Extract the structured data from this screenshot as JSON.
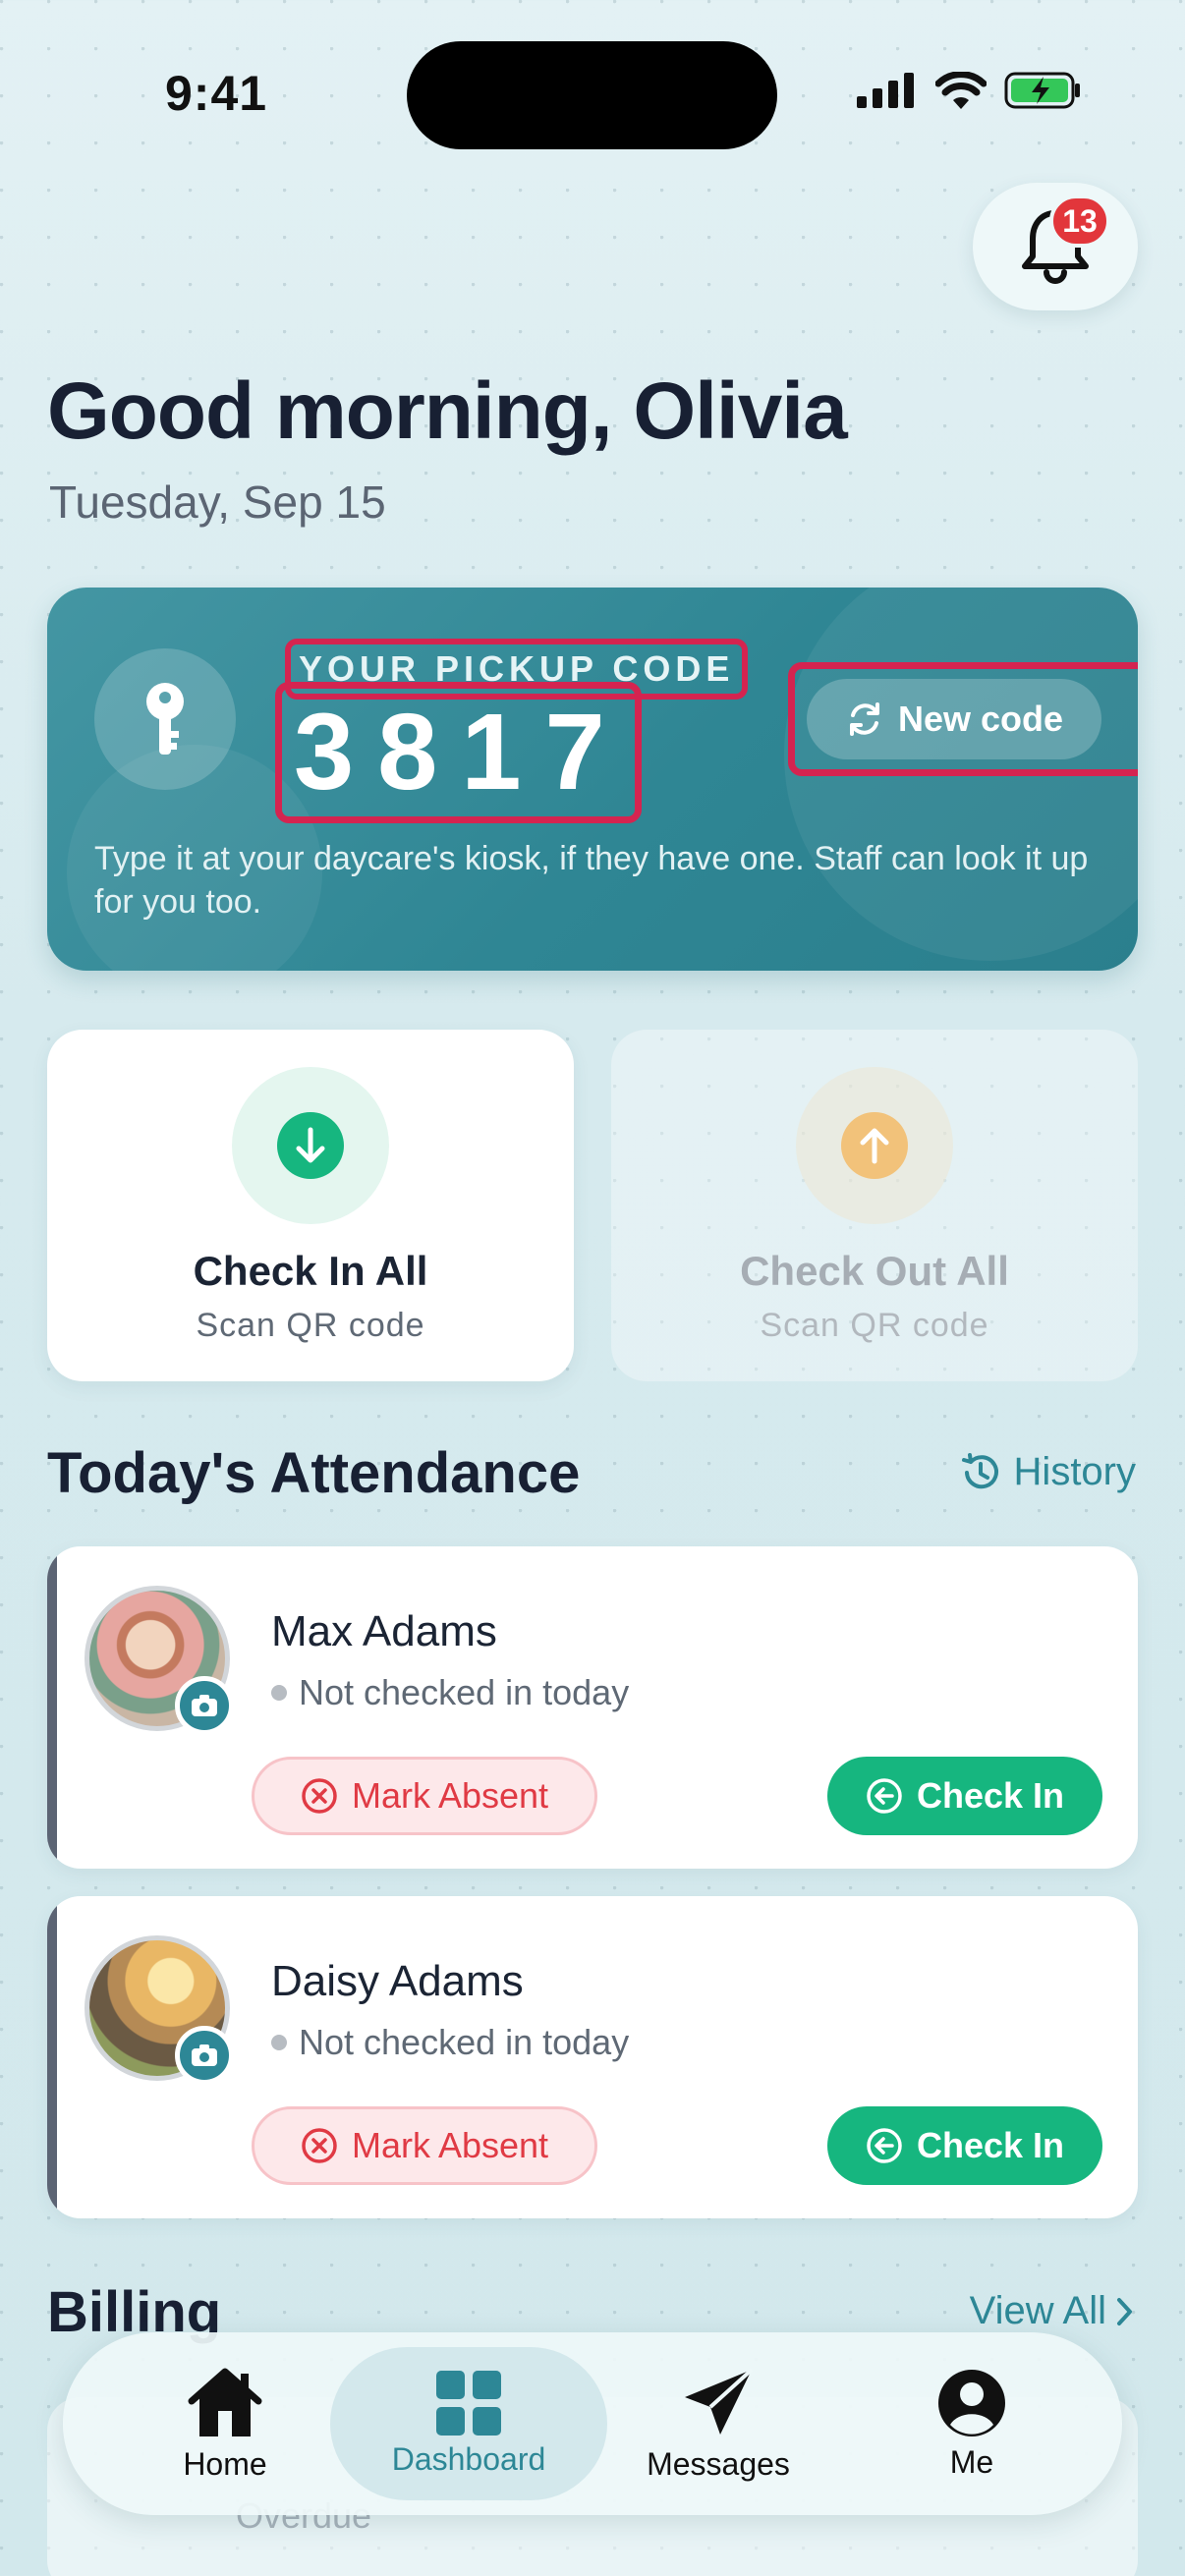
{
  "status_bar": {
    "time": "9:41"
  },
  "notifications": {
    "badge_count": "13"
  },
  "header": {
    "greeting": "Good morning, Olivia",
    "date": "Tuesday, Sep 15"
  },
  "pickup": {
    "label": "YOUR PICKUP CODE",
    "code": "3817",
    "new_code_label": "New code",
    "description": "Type it at your daycare's kiosk, if they have one. Staff can look it up for you too."
  },
  "actions": {
    "check_in": {
      "title": "Check In All",
      "subtitle": "Scan QR code"
    },
    "check_out": {
      "title": "Check Out All",
      "subtitle": "Scan QR code"
    }
  },
  "attendance": {
    "title": "Today's Attendance",
    "history_label": "History",
    "children": [
      {
        "name": "Max Adams",
        "status": "Not checked in today",
        "absent_label": "Mark Absent",
        "checkin_label": "Check In"
      },
      {
        "name": "Daisy Adams",
        "status": "Not checked in today",
        "absent_label": "Mark Absent",
        "checkin_label": "Check In"
      }
    ]
  },
  "billing": {
    "title": "Billing",
    "view_all_label": "View All",
    "overdue_label": "Overdue"
  },
  "tabbar": {
    "items": [
      {
        "label": "Home",
        "icon": "home-icon"
      },
      {
        "label": "Dashboard",
        "icon": "grid-icon"
      },
      {
        "label": "Messages",
        "icon": "paper-plane-icon"
      },
      {
        "label": "Me",
        "icon": "person-icon"
      }
    ],
    "active": "Dashboard"
  },
  "colors": {
    "accent": "#2d8796",
    "success": "#16b67f",
    "danger": "#e03a44",
    "highlight": "#d42450"
  }
}
